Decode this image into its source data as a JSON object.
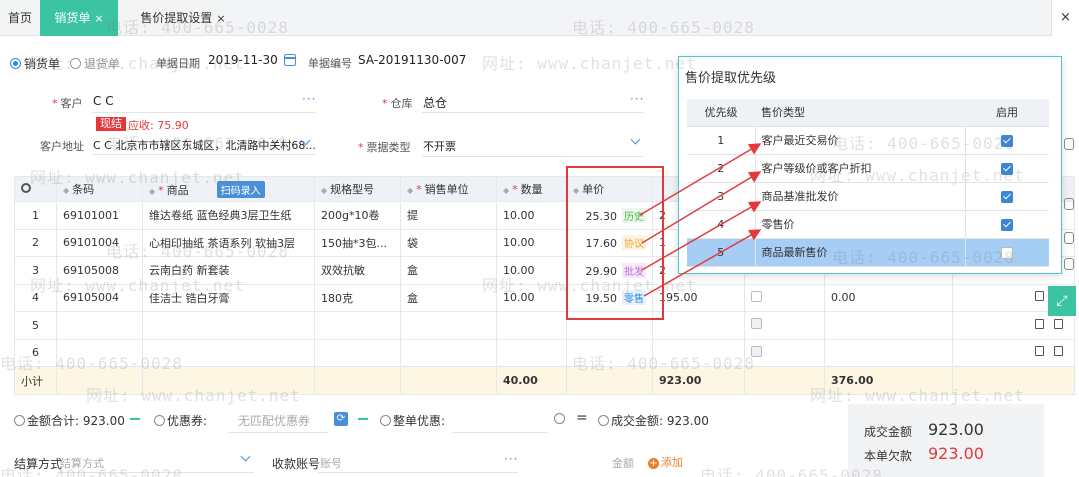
{
  "tabs": {
    "home": "首页",
    "active": "销货单",
    "second": "售价提取设置",
    "close_glyph": "×"
  },
  "header": {
    "radio_sale": "销货单",
    "radio_return": "退货单",
    "date_label": "单据日期",
    "date_value": "2019-11-30",
    "code_label": "单据编号",
    "code_value": "SA-20191130-007"
  },
  "form": {
    "customer_label": "客户",
    "customer_value": "C C",
    "warehouse_label": "仓库",
    "warehouse_value": "总仓",
    "settle_badge": "现结",
    "receivable": "应收: 75.90",
    "address_label": "客户地址",
    "address_value": "C C 北京市市辖区东城区，北清路中关村68...",
    "invoice_label": "票据类型",
    "invoice_value": "不开票",
    "more": "···"
  },
  "table": {
    "headers": {
      "barcode": "条码",
      "product": "商品",
      "scan": "扫码录入",
      "spec": "规格型号",
      "unit": "销售单位",
      "qty": "数量",
      "price": "单价"
    },
    "rows": [
      {
        "no": "1",
        "barcode": "69101001",
        "product": "维达卷纸 蓝色经典3层卫生纸",
        "spec": "200g*10卷",
        "unit": "提",
        "qty": "10.00",
        "price": "25.30",
        "tag": "历史",
        "c8": "2",
        "c9": "",
        "c10": ""
      },
      {
        "no": "2",
        "barcode": "69101004",
        "product": "心相印抽纸 茶语系列 软抽3层",
        "spec": "150抽*3包...",
        "unit": "袋",
        "qty": "10.00",
        "price": "17.60",
        "tag": "协议",
        "c8": "1",
        "c9": "",
        "c10": ""
      },
      {
        "no": "3",
        "barcode": "69105008",
        "product": "云南白药 新套装",
        "spec": "双效抗敏",
        "unit": "盒",
        "qty": "10.00",
        "price": "29.90",
        "tag": "批发",
        "c8": "2",
        "c9": "",
        "c10": ""
      },
      {
        "no": "4",
        "barcode": "69105004",
        "product": "佳洁士 锆白牙膏",
        "spec": "180克",
        "unit": "盒",
        "qty": "10.00",
        "price": "19.50",
        "tag": "零售",
        "c8": "195.00",
        "c9": "",
        "c10": "0.00"
      },
      {
        "no": "5"
      },
      {
        "no": "6"
      }
    ],
    "subtotal": {
      "label": "小计",
      "qty": "40.00",
      "amount": "923.00",
      "discount": "376.00"
    }
  },
  "popup": {
    "title": "售价提取优先级",
    "headers": {
      "priority": "优先级",
      "type": "售价类型",
      "enabled": "启用"
    },
    "rows": [
      {
        "priority": "1",
        "type": "客户最近交易价",
        "enabled": true
      },
      {
        "priority": "2",
        "type": "客户等级价或客户折扣",
        "enabled": true
      },
      {
        "priority": "3",
        "type": "商品基准批发价",
        "enabled": true
      },
      {
        "priority": "4",
        "type": "零售价",
        "enabled": true
      },
      {
        "priority": "5",
        "type": "商品最新售价",
        "enabled": false
      }
    ]
  },
  "footer": {
    "total_label": "金额合计:",
    "total_value": "923.00",
    "coupon_label": "优惠券:",
    "coupon_placeholder": "无匹配优惠券",
    "discount_label": "整单优惠:",
    "deal_label": "成交金额:",
    "deal_value": "923.00",
    "settle_label": "结算方式",
    "settle_placeholder": "结算方式",
    "account_label": "收款账号",
    "account_placeholder": "账号",
    "amount_label": "金额",
    "add_label": "添加",
    "box_deal_label": "成交金额",
    "box_deal_value": "923.00",
    "box_debt_label": "本单欠款",
    "box_debt_value": "923.00"
  },
  "watermark": {
    "phone": "电话: 400-665-0028",
    "site": "网址: www.chanjet.net"
  },
  "colors": {
    "accent": "#3cc3a1",
    "primary": "#4a90d9",
    "danger": "#e4393c",
    "highlight": "#a6cdf3"
  }
}
